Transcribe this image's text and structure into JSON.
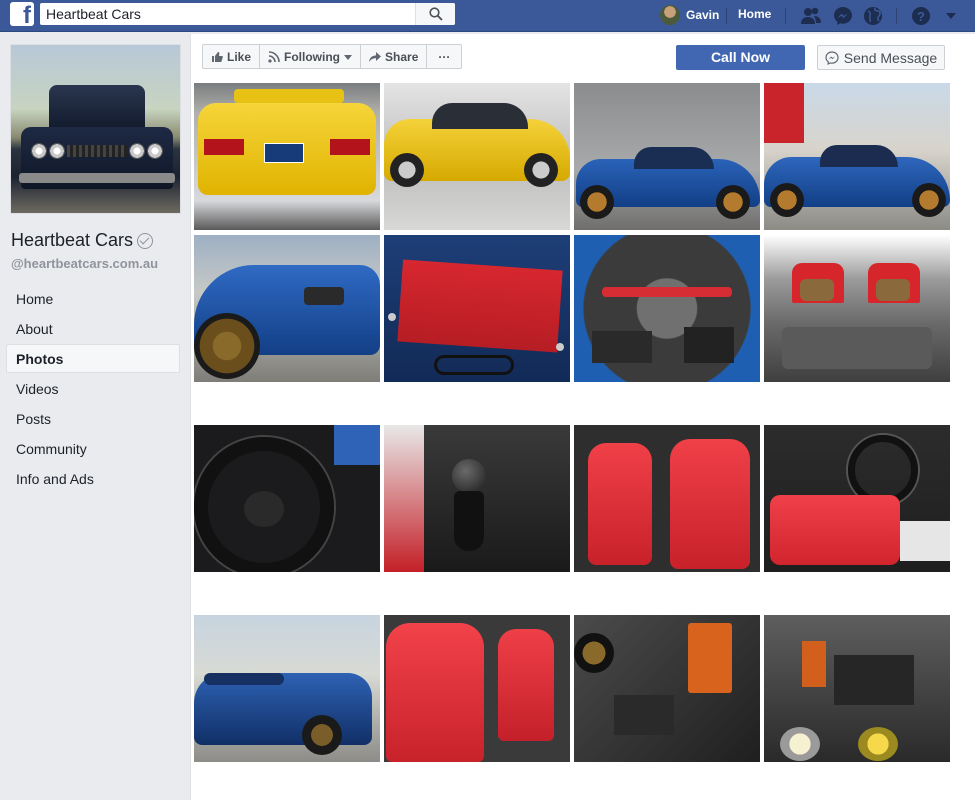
{
  "topbar": {
    "search_value": "Heartbeat Cars",
    "user_name": "Gavin",
    "home_label": "Home",
    "icons": [
      "friend-requests-icon",
      "messenger-icon",
      "notifications-globe-icon",
      "help-icon",
      "account-menu-icon"
    ],
    "bar_color": "#3b5998"
  },
  "page": {
    "name": "Heartbeat Cars",
    "handle": "@heartbeatcars.com.au"
  },
  "nav": {
    "items": [
      {
        "label": "Home"
      },
      {
        "label": "About"
      },
      {
        "label": "Photos"
      },
      {
        "label": "Videos"
      },
      {
        "label": "Posts"
      },
      {
        "label": "Community"
      },
      {
        "label": "Info and Ads"
      }
    ],
    "active": "Photos"
  },
  "actions": {
    "like": "Like",
    "following": "Following",
    "share": "Share",
    "more": "···",
    "call_now": "Call Now",
    "send_message": "Send Message"
  },
  "photos": [
    {
      "subject": "yellow-sedan-rear",
      "caption": ""
    },
    {
      "subject": "yellow-sedan-side",
      "caption": ""
    },
    {
      "subject": "blue-rx7-side-lot",
      "caption": ""
    },
    {
      "subject": "blue-rx7-side-street",
      "caption": ""
    },
    {
      "subject": "blue-rx7-front-wheel",
      "caption": ""
    },
    {
      "subject": "spirit-r-plaque",
      "caption": ""
    },
    {
      "subject": "rotary-engine-bay",
      "caption": ""
    },
    {
      "subject": "rear-cargo-seats",
      "caption": ""
    },
    {
      "subject": "steering-wheel",
      "caption": ""
    },
    {
      "subject": "gear-shifter",
      "caption": ""
    },
    {
      "subject": "red-recaro-seats",
      "caption": ""
    },
    {
      "subject": "interior-dash",
      "caption": ""
    },
    {
      "subject": "blue-rx7-rear",
      "caption": ""
    },
    {
      "subject": "red-recaro-seat-closeup",
      "caption": ""
    },
    {
      "subject": "engine-bay-battery",
      "caption": ""
    },
    {
      "subject": "front-lights-engine",
      "caption": ""
    }
  ]
}
